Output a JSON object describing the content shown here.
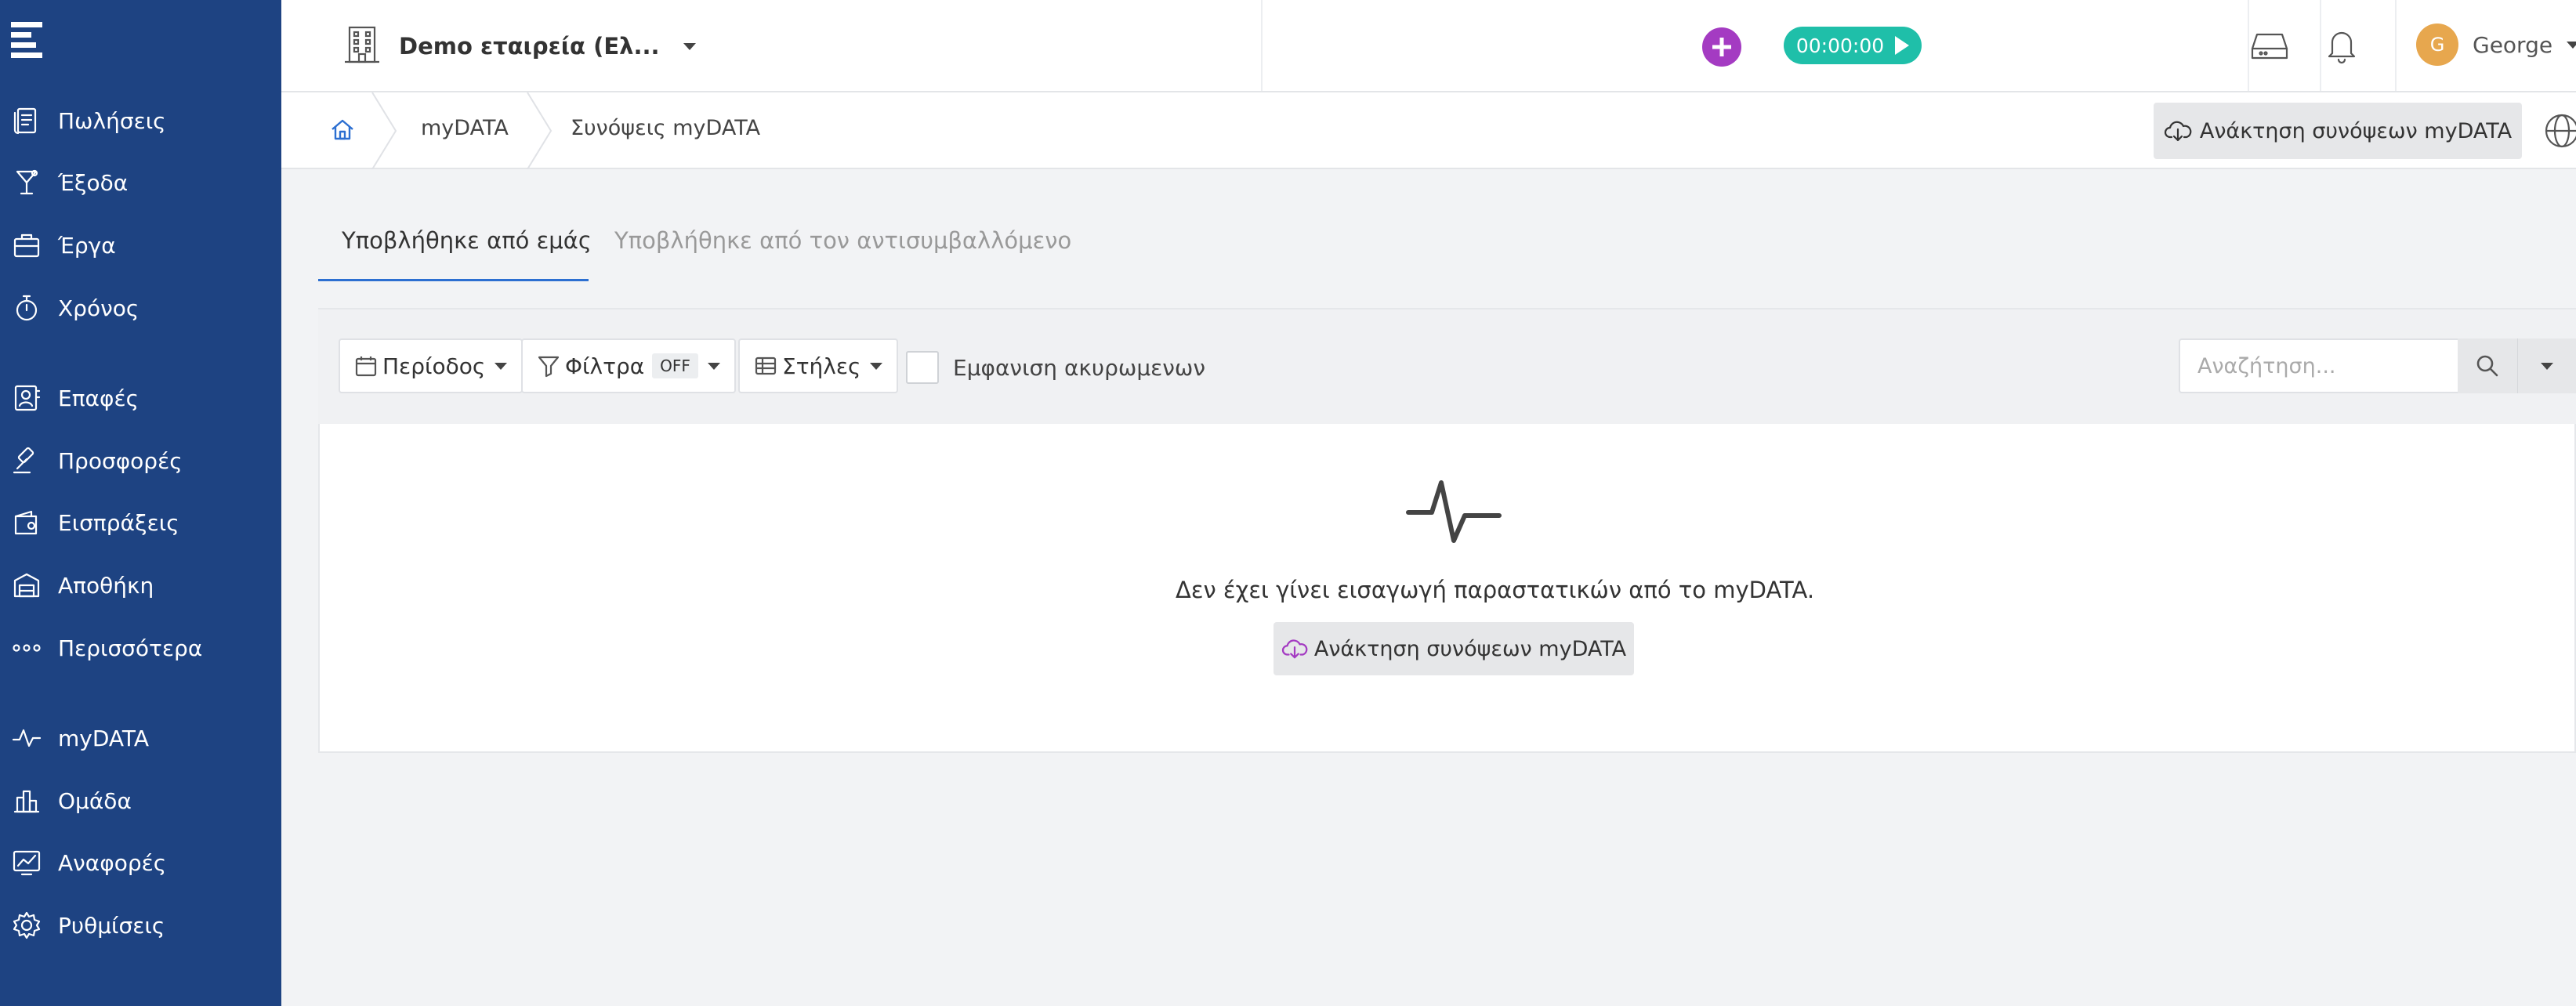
{
  "sidebar": {
    "items": [
      {
        "label": "Πωλήσεις",
        "icon": "sales-icon"
      },
      {
        "label": "Έξοδα",
        "icon": "expenses-icon"
      },
      {
        "label": "Έργα",
        "icon": "projects-icon"
      },
      {
        "label": "Χρόνος",
        "icon": "stopwatch-icon"
      },
      {
        "label": "Επαφές",
        "icon": "contacts-icon"
      },
      {
        "label": "Προσφορές",
        "icon": "gavel-icon"
      },
      {
        "label": "Εισπράξεις",
        "icon": "wallet-icon"
      },
      {
        "label": "Αποθήκη",
        "icon": "warehouse-icon"
      },
      {
        "label": "Περισσότερα",
        "icon": "more-dots-icon"
      },
      {
        "label": "myDATA",
        "icon": "pulse-icon"
      },
      {
        "label": "Ομάδα",
        "icon": "team-icon"
      },
      {
        "label": "Αναφορές",
        "icon": "reports-icon"
      },
      {
        "label": "Ρυθμίσεις",
        "icon": "gear-icon"
      }
    ]
  },
  "header": {
    "company": "Demo εταιρεία (Ελ...",
    "timer": "00:00:00",
    "user": {
      "initial": "G",
      "name": "George"
    },
    "colors": {
      "sidebar": "#1e4382",
      "plus": "#a43bc2",
      "timer": "#1fbfa9",
      "avatar": "#e7a74e",
      "accent": "#2c6fd1"
    }
  },
  "breadcrumb": {
    "items": [
      "myDATA",
      "Συνόψεις myDATA"
    ],
    "fetch_button": "Ανάκτηση συνόψεων myDATA"
  },
  "tabs": [
    {
      "label": "Υποβλήθηκε από εμάς",
      "active": true
    },
    {
      "label": "Υποβλήθηκε από τον αντισυμβαλλόμενο",
      "active": false
    }
  ],
  "toolbar": {
    "period": "Περίοδος",
    "filters": "Φίλτρα",
    "filters_state": "OFF",
    "columns": "Στήλες",
    "show_cancelled": "Εμφανιση ακυρωμενων",
    "search_placeholder": "Αναζήτηση..."
  },
  "empty_state": {
    "message": "Δεν έχει γίνει εισαγωγή παραστατικών από το myDATA.",
    "button": "Ανάκτηση συνόψεων myDATA"
  }
}
